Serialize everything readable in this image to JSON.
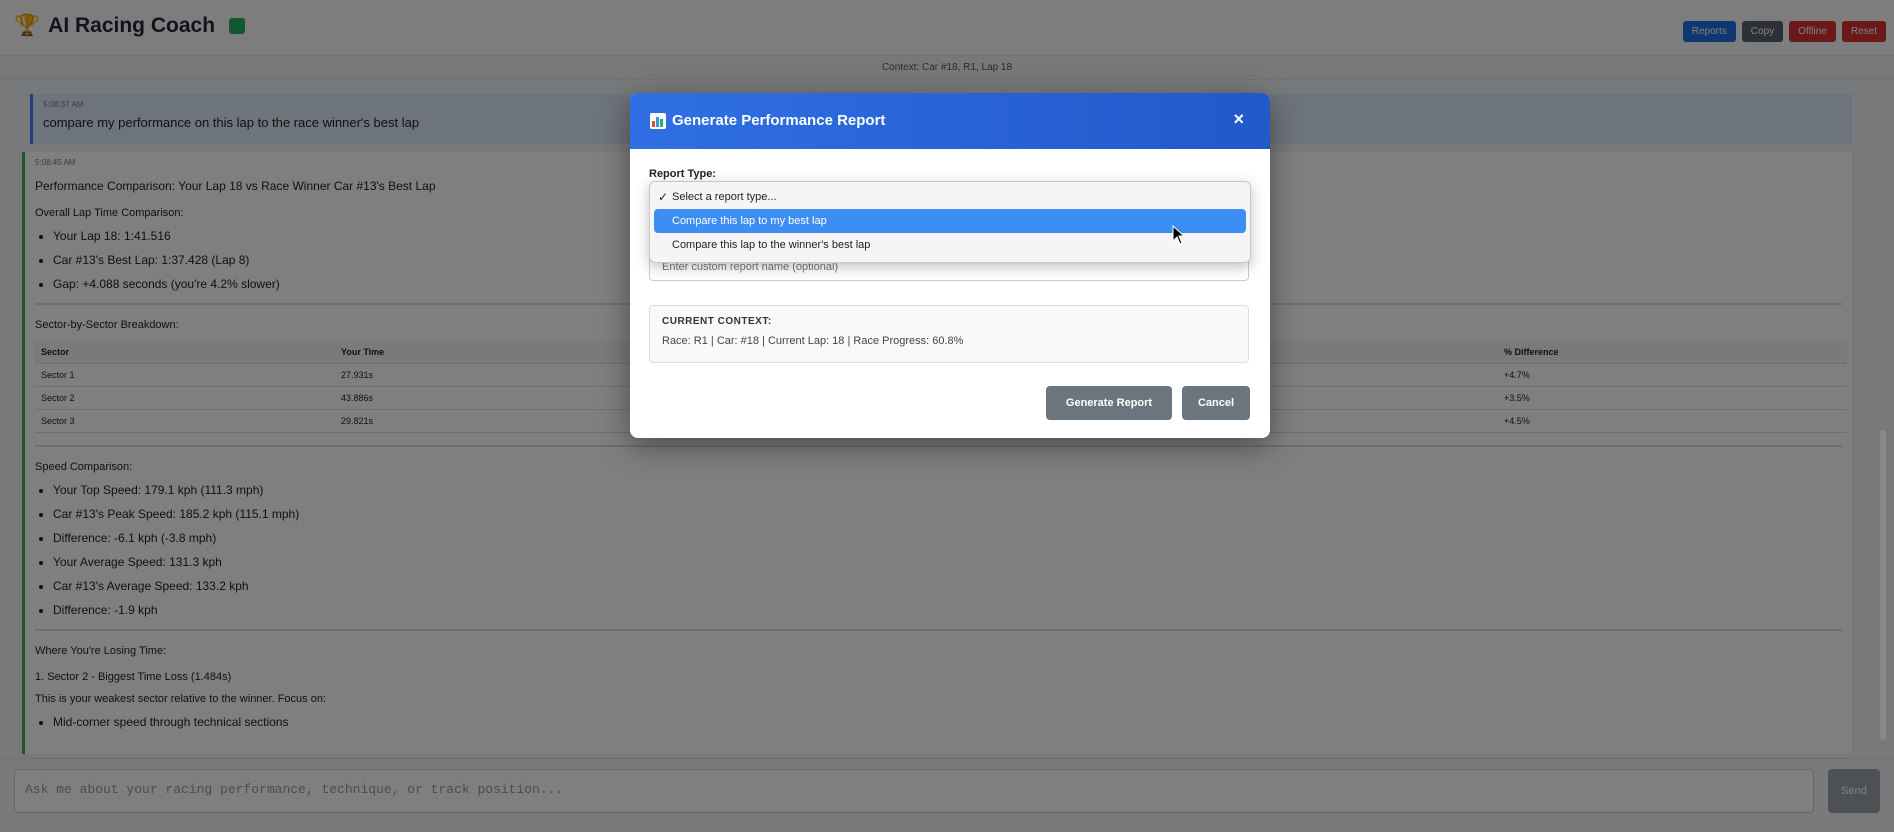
{
  "header": {
    "title": "AI Racing Coach",
    "buttons": [
      "Reports",
      "Copy",
      "Offline",
      "Reset"
    ]
  },
  "context_bar": "Context: Car #18, R1, Lap 18",
  "chat": {
    "user_time": "5:08:37 AM",
    "user_text": "compare my performance on this lap to the race winner's best lap",
    "bot_time": "5:08:45 AM",
    "bot_title": "Performance Comparison: Your Lap 18 vs Race Winner Car #13's Best Lap",
    "overall_head": "Overall Lap Time Comparison:",
    "overall": [
      "Your Lap 18: 1:41.516",
      "Car #13's Best Lap: 1:37.428 (Lap 8)",
      "Gap: +4.088 seconds (you're 4.2% slower)"
    ],
    "sector_head": "Sector-by-Sector Breakdown:",
    "table_headers": [
      "Sector",
      "Your Time",
      "",
      "% Difference"
    ],
    "table_rows": [
      [
        "Sector 1",
        "27.931s",
        "",
        "+4.7%"
      ],
      [
        "Sector 2",
        "43.886s",
        "",
        "+3.5%"
      ],
      [
        "Sector 3",
        "29.821s",
        "",
        "+4.5%"
      ]
    ],
    "speed_head": "Speed Comparison:",
    "speed": [
      "Your Top Speed: 179.1 kph (111.3 mph)",
      "Car #13's Peak Speed: 185.2 kph (115.1 mph)",
      "Difference: -6.1 kph (-3.8 mph)",
      "Your Average Speed: 131.3 kph",
      "Car #13's Average Speed: 133.2 kph",
      "Difference: -1.9 kph"
    ],
    "losing_head": "Where You're Losing Time:",
    "losing_1": "1. Sector 2 - Biggest Time Loss (1.484s)",
    "losing_2": "This is your weakest sector relative to the winner. Focus on:",
    "losing_3": "Mid-corner speed through technical sections"
  },
  "input": {
    "placeholder": "Ask me about your racing performance, technique, or track position...",
    "send": "Send"
  },
  "modal": {
    "title": "Generate Performance Report",
    "close": "×",
    "report_type_label": "Report Type:",
    "options": [
      "Select a report type...",
      "Compare this lap to my best lap",
      "Compare this lap to the winner's best lap"
    ],
    "checkmark": "✓",
    "name_placeholder": "Enter custom report name (optional)",
    "context_head": "CURRENT CONTEXT:",
    "context_text": "Race: R1 | Car: #18 | Current Lap: 18 | Race Progress: 60.8%",
    "generate_label": "Generate Report",
    "cancel_label": "Cancel"
  },
  "colors": {
    "accent": "#2f6fe4",
    "selected": "#3d8ef3",
    "button": "#6c757d"
  }
}
